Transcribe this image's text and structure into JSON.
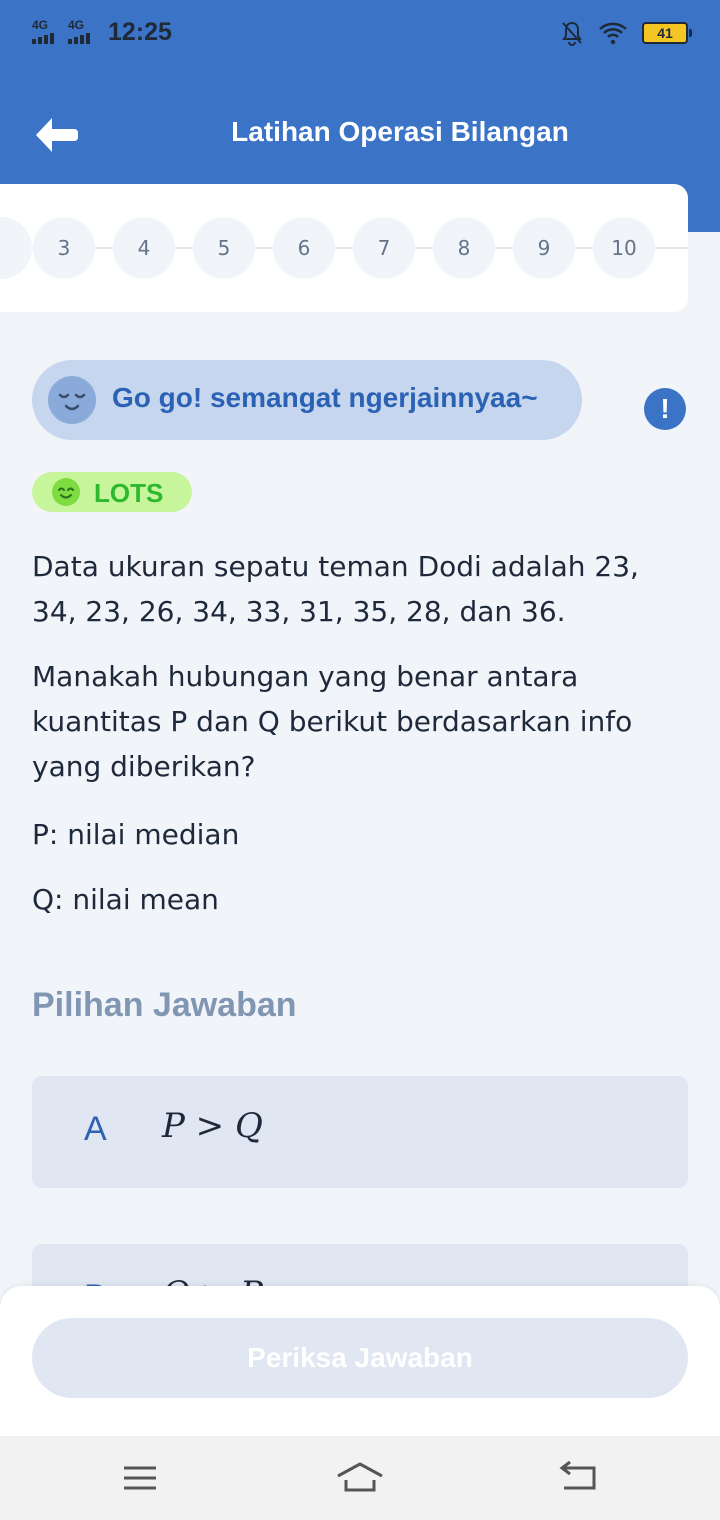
{
  "status_bar": {
    "network_1": "4G",
    "network_2": "4G",
    "time": "12:25",
    "battery": "41",
    "icons": [
      "signal-icon",
      "bell-muted-icon",
      "wifi-icon",
      "battery-icon"
    ]
  },
  "header": {
    "title": "Latihan Operasi Bilangan",
    "back_icon": "arrow-left-icon",
    "background": "#3b73c6"
  },
  "question_nav": {
    "numbers": [
      "3",
      "4",
      "5",
      "6",
      "7",
      "8",
      "9",
      "10"
    ]
  },
  "motivation": {
    "text": "Go go! semangat ngerjainnyaa~",
    "icon": "sleepy-face-icon"
  },
  "info_icon": "!",
  "level_badge": {
    "label": "LOTS",
    "icon": "smile-face-icon",
    "color": "#2db82d"
  },
  "question": {
    "paragraph_1": "Data ukuran sepatu teman Dodi adalah 23, 34, 23, 26, 34, 33, 31, 35, 28, dan 36.",
    "paragraph_2": "Manakah hubungan yang benar antara kuantitas P dan Q berikut berdasarkan info yang diberikan?",
    "paragraph_3": "P: nilai median",
    "paragraph_4": "Q: nilai mean"
  },
  "answers": {
    "heading": "Pilihan Jawaban",
    "options": [
      {
        "letter": "A",
        "text": "P > Q"
      },
      {
        "letter": "B",
        "text": "Q > P"
      }
    ]
  },
  "check_button": "Periksa Jawaban",
  "android_nav": {
    "icons": [
      "menu-icon",
      "home-icon",
      "back-icon"
    ]
  }
}
